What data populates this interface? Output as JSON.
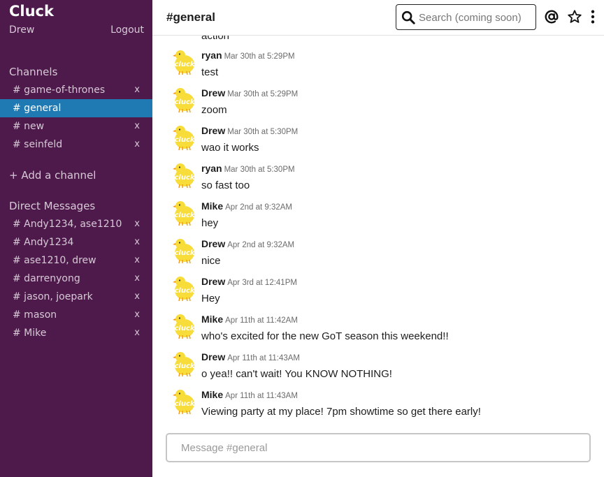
{
  "app": {
    "name": "Cluck"
  },
  "user": {
    "name": "Drew",
    "logout_label": "Logout"
  },
  "sidebar": {
    "channels_title": "Channels",
    "channels": [
      {
        "label": "# game-of-thrones",
        "close": "x"
      },
      {
        "label": "# general",
        "close": ""
      },
      {
        "label": "# new",
        "close": "x"
      },
      {
        "label": "# seinfeld",
        "close": "x"
      }
    ],
    "add_channel_label": "+ Add a channel",
    "dm_title": "Direct Messages",
    "dms": [
      {
        "label": "# Andy1234, ase1210",
        "close": "x"
      },
      {
        "label": "# Andy1234",
        "close": "x"
      },
      {
        "label": "# ase1210, drew",
        "close": "x"
      },
      {
        "label": "# darrenyong",
        "close": "x"
      },
      {
        "label": "# jason, joepark",
        "close": "x"
      },
      {
        "label": "# mason",
        "close": "x"
      },
      {
        "label": "# Mike",
        "close": "x"
      }
    ]
  },
  "header": {
    "channel_title": "#general",
    "search_placeholder": "Search (coming soon)",
    "icons": [
      "search-icon",
      "at-icon",
      "star-icon",
      "more-vertical-icon"
    ]
  },
  "messages": {
    "partial_text": "action",
    "items": [
      {
        "author": "ryan",
        "time": "Mar 30th at 5:29PM",
        "text": "test"
      },
      {
        "author": "Drew",
        "time": "Mar 30th at 5:29PM",
        "text": "zoom"
      },
      {
        "author": "Drew",
        "time": "Mar 30th at 5:30PM",
        "text": "wao it works"
      },
      {
        "author": "ryan",
        "time": "Mar 30th at 5:30PM",
        "text": "so fast too"
      },
      {
        "author": "Mike",
        "time": "Apr 2nd at 9:32AM",
        "text": "hey"
      },
      {
        "author": "Drew",
        "time": "Apr 2nd at 9:32AM",
        "text": "nice"
      },
      {
        "author": "Drew",
        "time": "Apr 3rd at 12:41PM",
        "text": "Hey"
      },
      {
        "author": "Mike",
        "time": "Apr 11th at 11:42AM",
        "text": "who's excited for the new GoT season this weekend!!"
      },
      {
        "author": "Drew",
        "time": "Apr 11th at 11:43AM",
        "text": "o yea!! can't wait! You KNOW NOTHING!"
      },
      {
        "author": "Mike",
        "time": "Apr 11th at 11:43AM",
        "text": "Viewing party at my place! 7pm showtime so get there early!"
      }
    ]
  },
  "composer": {
    "placeholder": "Message #general"
  },
  "colors": {
    "sidebar_bg": "#4d1a4b",
    "active_channel": "#1f7ab3",
    "avatar_yellow": "#f7dc3a"
  }
}
